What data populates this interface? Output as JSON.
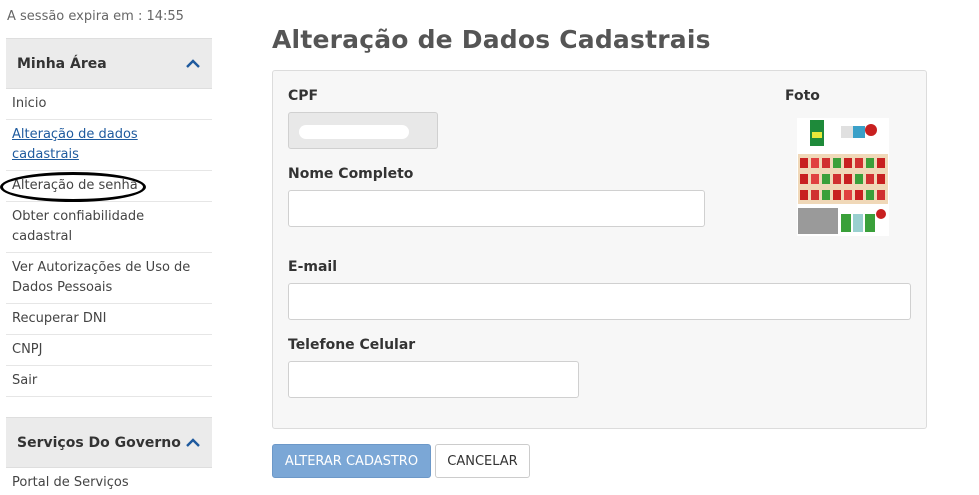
{
  "session": {
    "text": "A sessão expira em : 14:55"
  },
  "sidebar": {
    "panel_title": "Minha Área",
    "items": [
      {
        "label": "Inicio"
      },
      {
        "label": "Alteração de dados cadastrais"
      },
      {
        "label": "Alteração de senha"
      },
      {
        "label": "Obter confiabilidade cadastral"
      },
      {
        "label": "Ver Autorizações de Uso de Dados Pessoais"
      },
      {
        "label": "Recuperar DNI"
      },
      {
        "label": "CNPJ"
      },
      {
        "label": "Sair"
      }
    ],
    "panel2_title": "Serviços Do Governo",
    "panel2_items": [
      {
        "label": "Portal de Serviços"
      }
    ]
  },
  "main": {
    "title": "Alteração de Dados Cadastrais",
    "fields": {
      "cpf_label": "CPF",
      "nome_label": "Nome Completo",
      "email_label": "E-mail",
      "telefone_label": "Telefone Celular",
      "foto_label": "Foto"
    },
    "buttons": {
      "submit": "ALTERAR CADASTRO",
      "cancel": "CANCELAR"
    }
  },
  "colors": {
    "link": "#1e5a9e",
    "primary_button": "#7ba7d6"
  }
}
